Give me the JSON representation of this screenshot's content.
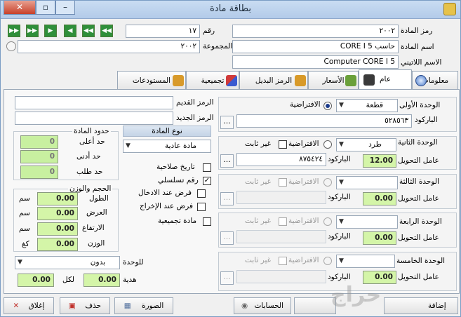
{
  "window": {
    "title": "بطاقة مادة"
  },
  "header": {
    "material_code_label": "رمز المادة",
    "material_code": "٢٠٠٢",
    "material_name_label": "اسم المادة",
    "material_name": "حاسب 5 CORE I",
    "latin_name_label": "الاسم اللاتيني",
    "latin_name": "Computer CORE I 5",
    "number_label": "رقم",
    "number": "١٧",
    "group_label": "المجموعة",
    "group": "٢٠٠٢"
  },
  "tabs": [
    {
      "label": "معلومات"
    },
    {
      "label": "عام"
    },
    {
      "label": "الأسعار"
    },
    {
      "label": "الرمز البديل"
    },
    {
      "label": "تجميعية"
    },
    {
      "label": "المستودعات"
    }
  ],
  "units": {
    "unit1_label": "الوحدة الأولى",
    "unit1_value": "قطعة",
    "default_label": "الافتراضية",
    "barcode_label": "الباركود",
    "barcode1": "٥٢٨٥٦٣",
    "unit2_label": "الوحدة الثانية",
    "unit2_value": "طرد",
    "not_fixed_label": "غير ثابت",
    "conversion_label": "عامل التحويل",
    "conversion2": "12.00",
    "barcode2": "٨٧٥٤٢٤",
    "unit3_label": "الوحدة الثالثة",
    "conversion3": "0.00",
    "unit4_label": "الوحدة الرابعة",
    "conversion4": "0.00",
    "unit5_label": "الوحدة الخامسة",
    "conversion5": "0.00",
    "dots": "..."
  },
  "left": {
    "old_code_label": "الرمز القديم",
    "new_code_label": "الرمز الجديد",
    "material_type_header": "نوع المادة",
    "material_type": "مادة عادية",
    "limits_header": "حدود المادة",
    "max_label": "حد أعلى",
    "max_value": "0",
    "min_label": "حد أدنى",
    "min_value": "0",
    "order_label": "حد طلب",
    "order_value": "0",
    "expiry_label": "تاريخ صلاحية",
    "serial_label": "رقم تسلسلي",
    "force_in_label": "فرض عند الادخال",
    "force_out_label": "فرض عند الإخراج",
    "assembly_label": "مادة تجميعية",
    "size_header": "الحجم والوزن",
    "length_label": "الطول",
    "length_value": "0.00",
    "width_label": "العرض",
    "width_value": "0.00",
    "height_label": "الارتفاع",
    "height_value": "0.00",
    "weight_label": "الوزن",
    "weight_value": "0.00",
    "unit_cm": "سم",
    "unit_kg": "كغ",
    "for_unit_label": "للوحدة",
    "for_unit_value": "بدون",
    "gift_label": "هدية",
    "gift_value": "0.00",
    "per_label": "لكل",
    "per_value": "0.00",
    "check_mark": "✓"
  },
  "footer": {
    "add": "إضافة",
    "accounts": "الحسابات",
    "image": "الصورة",
    "delete": "حذف",
    "close": "إغلاق",
    "watermark": "حراج"
  }
}
